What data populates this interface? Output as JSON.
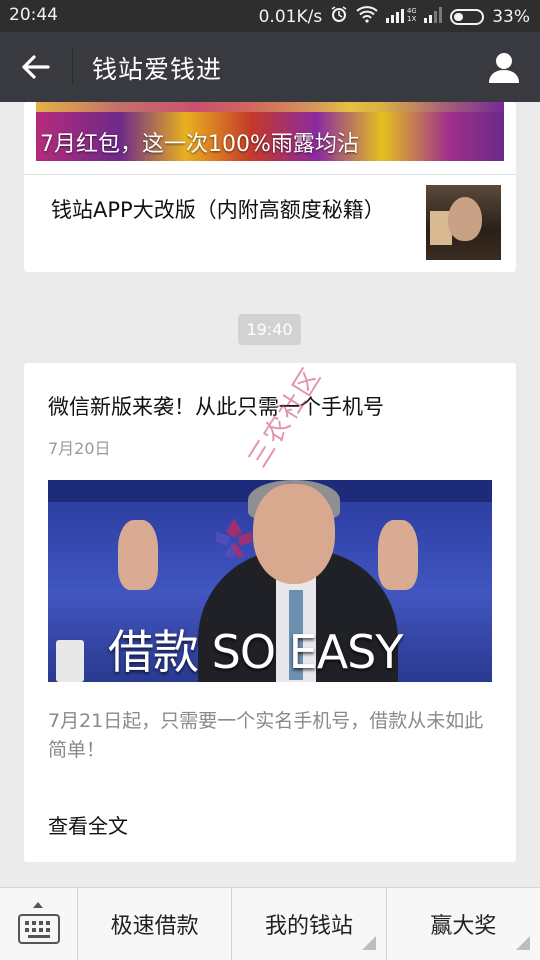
{
  "status_bar": {
    "time": "20:44",
    "network_speed": "0.01K/s",
    "signal_label": "4G 1X",
    "battery_percent": "33%",
    "battery_level": 0.33,
    "icons": [
      "alarm-icon",
      "wifi-icon",
      "signal-icon",
      "battery-icon"
    ]
  },
  "header": {
    "title": "钱站爱钱进",
    "back_icon": "back-arrow-icon",
    "profile_icon": "person-icon"
  },
  "top_card": {
    "banner_caption": "7月红包，这一次100%雨露均沾",
    "sub_article_title": "钱站APP大改版（内附高额度秘籍）"
  },
  "timestamp": "19:40",
  "main_card": {
    "title": "微信新版来袭！从此只需一个手机号",
    "date": "7月20日",
    "cover_caption": "借款 SO EASY",
    "summary": "7月21日起，只需要一个实名手机号，借款从未如此简单！",
    "read_more": "查看全文"
  },
  "watermark_text": "三农社区",
  "bottom_menu": {
    "keyboard_icon": "keyboard-icon",
    "items": [
      {
        "label": "极速借款",
        "has_submenu": false
      },
      {
        "label": "我的钱站",
        "has_submenu": true
      },
      {
        "label": "赢大奖",
        "has_submenu": true
      }
    ]
  },
  "colors": {
    "title_bar": "#393a3f",
    "status_bar": "#2e2e2e",
    "background": "#ebebeb",
    "timestamp_bg": "#d2d2d2"
  }
}
